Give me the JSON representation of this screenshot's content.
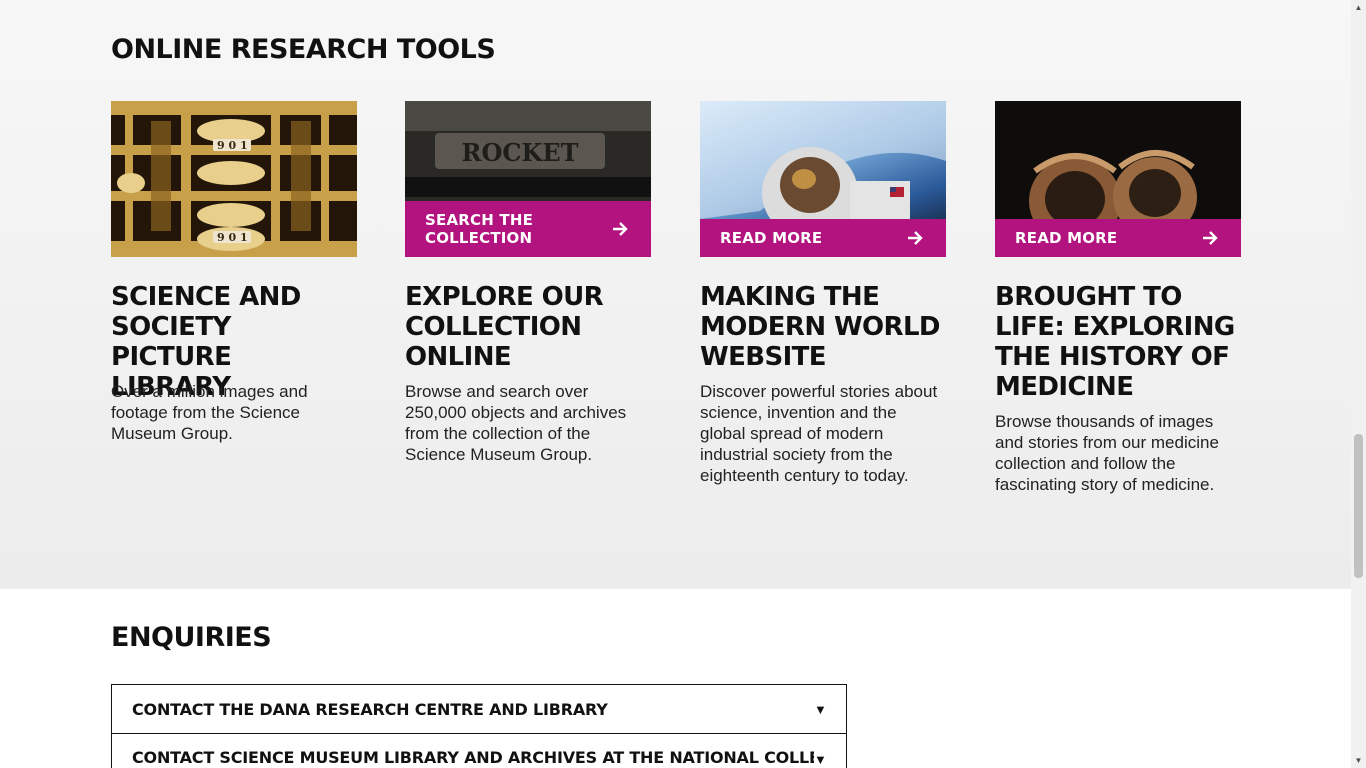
{
  "research_tools": {
    "title": "ONLINE RESEARCH TOOLS",
    "cards": [
      {
        "title": "SCIENCE AND SOCIETY PICTURE LIBRARY",
        "description": "Over a million images and footage from the Science Museum Group.",
        "image": "difference-engine-gears"
      },
      {
        "title": "EXPLORE OUR COLLECTION ONLINE",
        "description": "Browse and search over 250,000 objects and archives from the collection of the Science Museum Group.",
        "cta": "SEARCH THE COLLECTION",
        "image_text": "ROCKET",
        "image": "rocket-locomotive-nameplate"
      },
      {
        "title": "MAKING THE MODERN WORLD WEBSITE",
        "description": "Discover powerful stories about science, invention and the global spread of modern industrial society from the eighteenth century to today.",
        "cta": "READ MORE",
        "image": "astronaut-spacewalk"
      },
      {
        "title": "BROUGHT TO LIFE: EXPLORING THE HISTORY OF MEDICINE",
        "description": "Browse thousands of images and stories from our medicine collection and follow the fascinating story of medicine.",
        "cta": "READ MORE",
        "image": "brass-helmets"
      }
    ]
  },
  "enquiries": {
    "title": "ENQUIRIES",
    "items": [
      {
        "label": "CONTACT THE DANA RESEARCH CENTRE AND LIBRARY"
      },
      {
        "label": "CONTACT SCIENCE MUSEUM LIBRARY AND ARCHIVES AT THE NATIONAL COLLECTIONS"
      }
    ]
  },
  "colors": {
    "accent": "#b2137f",
    "text": "#111111",
    "section_bg": "#f0f0f0"
  }
}
